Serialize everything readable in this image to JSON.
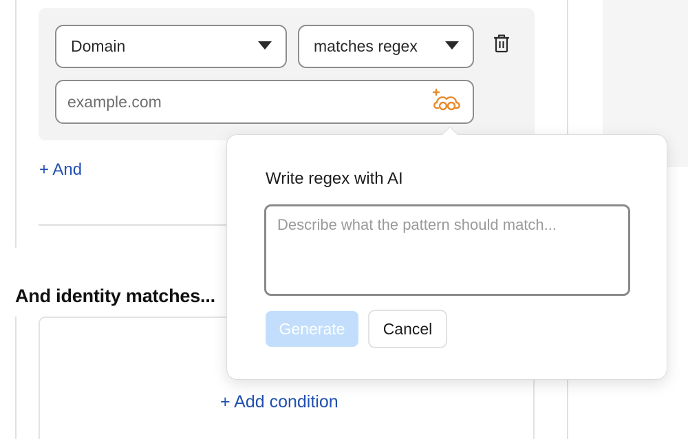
{
  "condition": {
    "field_select": {
      "value": "Domain"
    },
    "operator_select": {
      "value": "matches regex"
    },
    "value_input": {
      "value": "",
      "placeholder": "example.com"
    }
  },
  "add_and_label": "+ And",
  "identity_section": {
    "title": "And identity matches...",
    "add_condition_label": "+ Add condition"
  },
  "ai_popover": {
    "title": "Write regex with AI",
    "textarea_placeholder": "Describe what the pattern should match...",
    "generate_label": "Generate",
    "cancel_label": "Cancel"
  },
  "icons": {
    "delete": "trash-icon",
    "ai": "ai-sparkle-icon",
    "dropdown": "chevron-down-icon"
  },
  "colors": {
    "link_blue": "#2050b0",
    "ai_orange": "#e8892b",
    "generate_disabled": "#c2defc"
  }
}
